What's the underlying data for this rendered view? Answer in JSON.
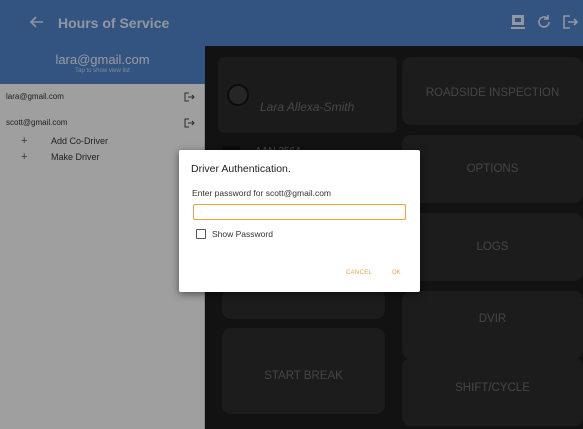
{
  "header": {
    "title": "Hours of Service"
  },
  "drawer": {
    "current_email": "lara@gmail.com",
    "current_hint": "Tap to show view list",
    "accounts": [
      {
        "email": "lara@gmail.com"
      },
      {
        "email": "scott@gmail.com"
      }
    ],
    "sub_items": [
      {
        "label": "Add Co-Driver"
      },
      {
        "label": "Make Driver"
      }
    ]
  },
  "main": {
    "driver_name": "Lara Allexa-Smith",
    "vehicle": "AAN 2564",
    "tiles": {
      "roadside": "ROADSIDE INSPECTION",
      "options": "OPTIONS",
      "logs": "LOGS",
      "dvir": "DVIR",
      "start_break": "START BREAK",
      "shift_cycle": "SHIFT/CYCLE"
    }
  },
  "dialog": {
    "title": "Driver Authentication.",
    "prompt": "Enter password for scott@gmail.com",
    "password_value": "",
    "show_password_label": "Show Password",
    "cancel_label": "CANCEL",
    "ok_label": "OK"
  },
  "colors": {
    "header_blue": "#4f81c7",
    "accent_orange": "#e8a33e"
  },
  "icons": {
    "back": "arrow-left-icon",
    "toolbar": [
      "screen-lock-icon",
      "refresh-icon",
      "logout-icon"
    ],
    "account_action": "logout-icon",
    "add": "plus-icon"
  }
}
